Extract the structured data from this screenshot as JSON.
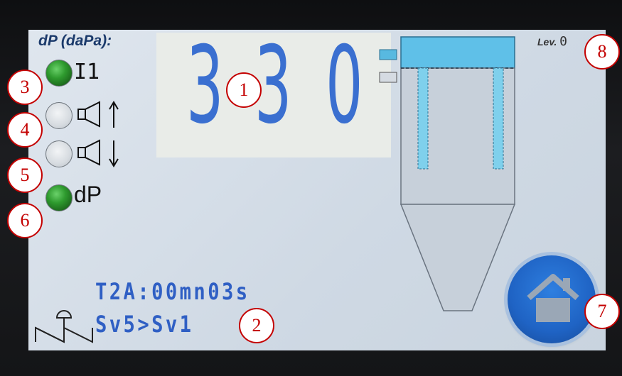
{
  "display": {
    "title": "dP (daPa):",
    "value_digits": [
      "3",
      "3",
      "0"
    ],
    "level_label": "Lev.",
    "level_value": "0"
  },
  "indicators": [
    {
      "label": "I1",
      "state": "on",
      "icon": "input-icon"
    },
    {
      "label": "",
      "state": "off",
      "icon": "horn-up-icon"
    },
    {
      "label": "",
      "state": "off",
      "icon": "horn-down-icon"
    },
    {
      "label": "dP",
      "state": "on",
      "icon": "dp-icon"
    }
  ],
  "info": {
    "timer": "T2A:00mn03s",
    "valve_seq": "Sv5>Sv1"
  },
  "callouts": [
    "1",
    "2",
    "3",
    "4",
    "5",
    "6",
    "7",
    "8"
  ],
  "colors": {
    "accent": "#3a6fd0",
    "led_on": "#2e9a2e",
    "callout": "#c40000",
    "filter_top": "#58b9e0"
  }
}
